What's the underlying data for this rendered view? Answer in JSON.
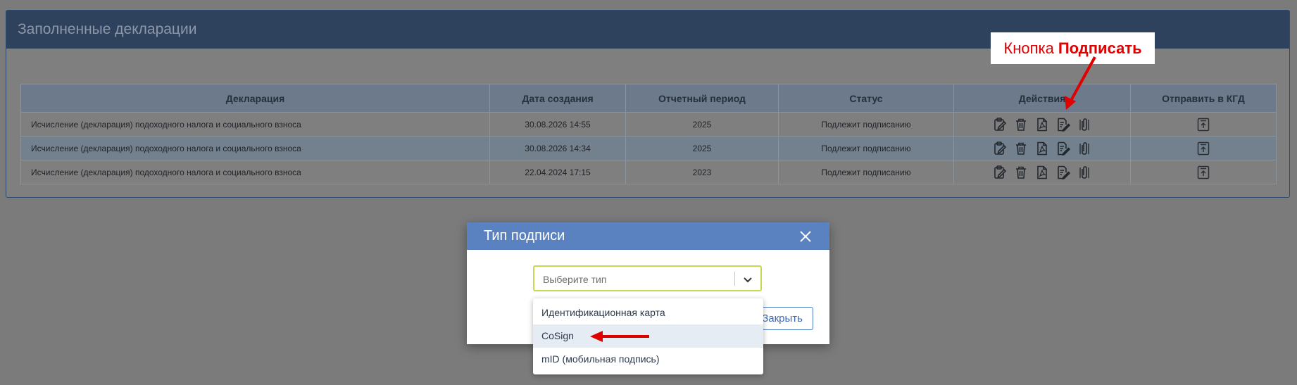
{
  "panel": {
    "title": "Заполненные декларации"
  },
  "table": {
    "headers": [
      "Декларация",
      "Дата создания",
      "Отчетный период",
      "Статус",
      "Действия",
      "Отправить в КГД"
    ],
    "rows": [
      {
        "declaration": "Исчисление (декларация) подоходного налога и социального взноса",
        "created": "30.08.2026 14:55",
        "period": "2025",
        "status": "Подлежит подписанию"
      },
      {
        "declaration": "Исчисление (декларация) подоходного налога и социального взноса",
        "created": "30.08.2026 14:34",
        "period": "2025",
        "status": "Подлежит подписанию"
      },
      {
        "declaration": "Исчисление (декларация) подоходного налога и социального взноса",
        "created": "22.04.2024 17:15",
        "period": "2023",
        "status": "Подлежит подписанию"
      }
    ],
    "action_icons": [
      "edit-clipboard-icon",
      "trash-icon",
      "pdf-file-icon",
      "sign-document-icon",
      "attachment-icon"
    ],
    "send_icon": "upload-to-kgd-icon"
  },
  "callout": {
    "prefix": "Кнопка",
    "bold": "Подписать"
  },
  "modal": {
    "title": "Тип подписи",
    "select": {
      "placeholder": "Выберите тип"
    },
    "options": [
      "Идентификационная карта",
      "CoSign",
      "mID (мобильная подпись)"
    ],
    "highlighted_option": "CoSign",
    "close_button": "Закрыть"
  },
  "colors": {
    "header": "#2e415d",
    "modal_header": "#5b82c0",
    "annotation": "#e00000"
  }
}
